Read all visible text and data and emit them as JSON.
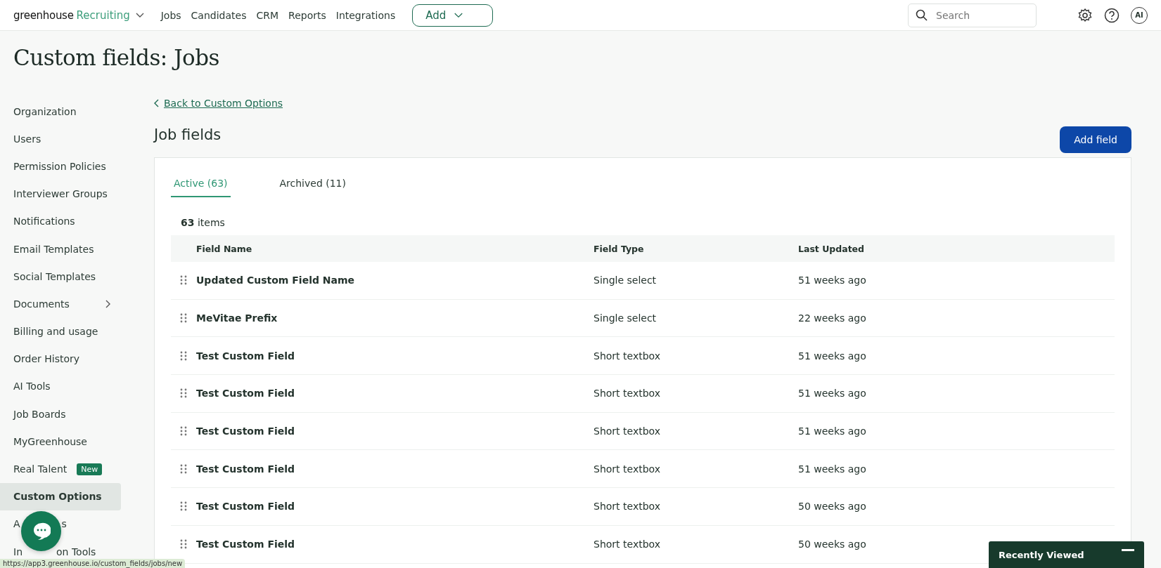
{
  "topbar": {
    "brand": "greenhouse",
    "product": "Recruiting",
    "nav": [
      {
        "label": "Jobs"
      },
      {
        "label": "Candidates"
      },
      {
        "label": "CRM"
      },
      {
        "label": "Reports"
      },
      {
        "label": "Integrations"
      }
    ],
    "add_button": "Add",
    "search": {
      "placeholder": "Search"
    },
    "avatar": "AI"
  },
  "page_title": "Custom fields: Jobs",
  "sidebar": {
    "items": [
      {
        "label": "Organization",
        "selected": false
      },
      {
        "label": "Users",
        "selected": false
      },
      {
        "label": "Permission Policies",
        "selected": false
      },
      {
        "label": "Interviewer Groups",
        "selected": false
      },
      {
        "label": "Notifications",
        "selected": false
      },
      {
        "label": "Email Templates",
        "selected": false
      },
      {
        "label": "Social Templates",
        "selected": false
      },
      {
        "label": "Documents",
        "selected": false,
        "expandable": true
      },
      {
        "label": "Billing and usage",
        "selected": false
      },
      {
        "label": "Order History",
        "selected": false
      },
      {
        "label": "AI Tools",
        "selected": false
      },
      {
        "label": "Job Boards",
        "selected": false
      },
      {
        "label": "MyGreenhouse",
        "selected": false
      },
      {
        "label": "Real Talent",
        "selected": false,
        "badge": "New"
      },
      {
        "label": "Custom Options",
        "selected": true
      },
      {
        "label": "A",
        "label_end": "s",
        "selected": false
      },
      {
        "label": "In",
        "label_end": "on Tools",
        "selected": false
      }
    ]
  },
  "back_link": "Back to Custom Options",
  "section_title": "Job fields",
  "add_field_button": "Add field",
  "tabs": [
    {
      "label": "Active (63)",
      "selected": true
    },
    {
      "label": "Archived (11)",
      "selected": false
    }
  ],
  "item_count": "**63** items",
  "table": {
    "columns": [
      "Field Name",
      "Field Type",
      "Last Updated"
    ],
    "rows": [
      [
        "Updated Custom Field Name",
        "Single select",
        "51 weeks ago"
      ],
      [
        "MeVitae Prefix",
        "Single select",
        "22 weeks ago"
      ],
      [
        "Test Custom Field",
        "Short textbox",
        "51 weeks ago"
      ],
      [
        "Test Custom Field",
        "Short textbox",
        "51 weeks ago"
      ],
      [
        "Test Custom Field",
        "Short textbox",
        "51 weeks ago"
      ],
      [
        "Test Custom Field",
        "Short textbox",
        "51 weeks ago"
      ],
      [
        "Test Custom Field",
        "Short textbox",
        "50 weeks ago"
      ],
      [
        "Test Custom Field",
        "Short textbox",
        "50 weeks ago"
      ]
    ]
  },
  "status_url": "https://app3.greenhouse.io/custom_fields/jobs/new",
  "recently_viewed": "Recently Viewed"
}
